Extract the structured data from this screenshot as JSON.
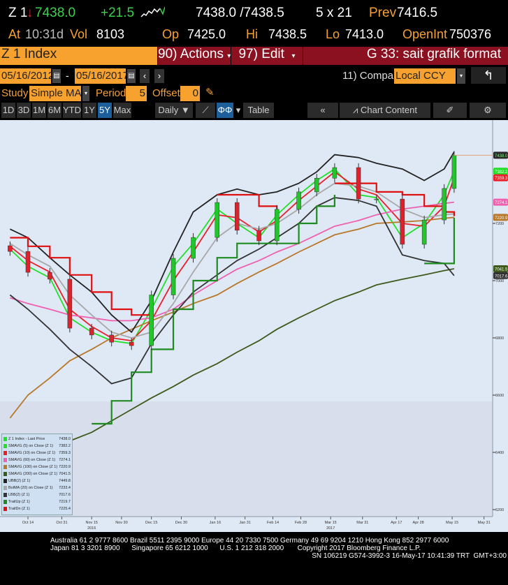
{
  "quote": {
    "ticker": "Z 1",
    "last": "7438.0",
    "change": "+21.5",
    "bid_ask": "7438.0 /7438.5",
    "size": "5 x 21",
    "prev_label": "Prev",
    "prev": "7416.5",
    "at_label": "At",
    "time": "10:31d",
    "vol_label": "Vol",
    "vol": "8103",
    "op_label": "Op",
    "op": "7425.0",
    "hi_label": "Hi",
    "hi": "7438.5",
    "lo_label": "Lo",
    "lo": "7413.0",
    "oi_label": "OpenInt",
    "oi": "750376"
  },
  "menu": {
    "security": "Z 1 Index",
    "actions": "90) Actions",
    "edit": "97) Edit",
    "title": "G 33: sait grafik format"
  },
  "range": {
    "start": "05/16/2012",
    "sep": "-",
    "end": "05/16/2017",
    "compare_label": "11) Compare",
    "compare": "Local CCY"
  },
  "study": {
    "label": "Study",
    "value": "Simple MA",
    "period_label": "Period",
    "period": "5",
    "offset_label": "Offset",
    "offset": "0"
  },
  "toolbar": {
    "periods": [
      "1D",
      "3D",
      "1M",
      "6M",
      "YTD",
      "1Y",
      "5Y",
      "Max"
    ],
    "selected": "5Y",
    "frequency": "Daily ▼",
    "table": "Table",
    "chart_content": "Chart Content"
  },
  "colors": {
    "accent": "#f7a12e",
    "menu_red": "#8b1020",
    "up": "#22c62a",
    "down": "#e0202a"
  },
  "chart_data": {
    "type": "candlestick-line",
    "yticks": [
      6200,
      6400,
      6600,
      6800,
      7000,
      7200
    ],
    "ylim": [
      6150,
      7500
    ],
    "xticks": [
      {
        "d": "2016-10-14",
        "l": "Oct 14"
      },
      {
        "d": "2016-10-31",
        "l": "Oct 31"
      },
      {
        "d": "2016-11-15",
        "l": "Nov 15"
      },
      {
        "d": "2016-11-30",
        "l": "Nov 30"
      },
      {
        "d": "2016-12-15",
        "l": "Dec 15"
      },
      {
        "d": "2016-12-30",
        "l": "Dec 30"
      },
      {
        "d": "2017-01-16",
        "l": "Jan 16"
      },
      {
        "d": "2017-01-31",
        "l": "Jan 31"
      },
      {
        "d": "2017-02-14",
        "l": "Feb 14"
      },
      {
        "d": "2017-02-28",
        "l": "Feb 28"
      },
      {
        "d": "2017-03-15",
        "l": "Mar 15"
      },
      {
        "d": "2017-03-31",
        "l": "Mar 31"
      },
      {
        "d": "2017-04-17",
        "l": "Apr 17"
      },
      {
        "d": "2017-04-28",
        "l": "Apr 28"
      },
      {
        "d": "2017-05-15",
        "l": "May 15"
      },
      {
        "d": "2017-05-31",
        "l": "May 31"
      }
    ],
    "years": [
      {
        "d": "2016-11-15",
        "l": "2016"
      },
      {
        "d": "2017-03-15",
        "l": "2017"
      }
    ],
    "dates": [
      "2016-10-05",
      "2016-10-14",
      "2016-10-25",
      "2016-11-04",
      "2016-11-15",
      "2016-11-25",
      "2016-12-05",
      "2016-12-15",
      "2016-12-26",
      "2017-01-05",
      "2017-01-17",
      "2017-01-27",
      "2017-02-07",
      "2017-02-16",
      "2017-02-27",
      "2017-03-08",
      "2017-03-17",
      "2017-03-29",
      "2017-04-07",
      "2017-04-20",
      "2017-05-01",
      "2017-05-11",
      "2017-05-16"
    ],
    "close": [
      7102,
      7029,
      7005,
      6834,
      6810,
      6785,
      6773,
      6950,
      7078,
      7151,
      7273,
      7176,
      7139,
      7249,
      7310,
      7358,
      7395,
      7285,
      7285,
      7127,
      7212,
      7322,
      7438
    ],
    "series": [
      {
        "name": "SMAVG (5) on Close (Z 1)",
        "last": "7382.2",
        "color": "#22e02a",
        "values": [
          7110,
          7050,
          7010,
          6870,
          6820,
          6790,
          6780,
          6900,
          7050,
          7130,
          7250,
          7200,
          7150,
          7230,
          7300,
          7350,
          7390,
          7300,
          7290,
          7150,
          7200,
          7300,
          7382.2
        ]
      },
      {
        "name": "SMAVG (10) on Close (Z 1)",
        "last": "7359.3",
        "color": "#e8202a",
        "values": [
          7120,
          7070,
          7030,
          6900,
          6840,
          6800,
          6790,
          6860,
          7000,
          7100,
          7230,
          7220,
          7170,
          7210,
          7280,
          7330,
          7380,
          7320,
          7300,
          7200,
          7190,
          7260,
          7359.3
        ]
      },
      {
        "name": "SMAVG (60) on Close (Z 1)",
        "last": "7274.1",
        "color": "#f060b0",
        "values": [
          6940,
          6920,
          6900,
          6880,
          6870,
          6860,
          6860,
          6870,
          6900,
          6950,
          7000,
          7040,
          7070,
          7100,
          7130,
          7160,
          7190,
          7210,
          7230,
          7250,
          7260,
          7270,
          7274.1
        ]
      },
      {
        "name": "SMAVG (100) on Close (Z 1)",
        "last": "7220.9",
        "color": "#b8782a",
        "values": [
          6520,
          6600,
          6660,
          6720,
          6760,
          6800,
          6830,
          6860,
          6890,
          6920,
          6950,
          6990,
          7030,
          7060,
          7100,
          7130,
          7160,
          7180,
          7200,
          7205,
          7210,
          7218,
          7220.9
        ]
      },
      {
        "name": "SMAVG (200) on Close (Z 1)",
        "last": "7041.5",
        "color": "#3d5a1a",
        "values": [
          6370,
          6390,
          6410,
          6440,
          6470,
          6510,
          6550,
          6590,
          6630,
          6670,
          6710,
          6750,
          6790,
          6830,
          6870,
          6900,
          6930,
          6960,
          6985,
          7005,
          7020,
          7035,
          7041.5
        ]
      },
      {
        "name": "UBB(2) (Z 1)",
        "last": "7449.8",
        "color": "#222222",
        "values": [
          7180,
          7150,
          7080,
          7020,
          6960,
          6880,
          6820,
          6930,
          7100,
          7240,
          7300,
          7320,
          7300,
          7310,
          7340,
          7380,
          7440,
          7430,
          7410,
          7390,
          7350,
          7390,
          7449.8
        ]
      },
      {
        "name": "BolMA (20) on Close (Z 1)",
        "last": "7233.4",
        "color": "#a8a8a8",
        "values": [
          7130,
          7090,
          7050,
          6950,
          6880,
          6820,
          6800,
          6820,
          6920,
          7030,
          7150,
          7200,
          7180,
          7200,
          7250,
          7300,
          7340,
          7330,
          7310,
          7250,
          7220,
          7230,
          7233.4
        ]
      },
      {
        "name": "LBB(2) (Z 1)",
        "last": "7017.6",
        "color": "#333333",
        "values": [
          6950,
          6900,
          6830,
          6760,
          6700,
          6640,
          6660,
          6780,
          6880,
          6960,
          7020,
          7070,
          7110,
          7150,
          7200,
          7260,
          7290,
          7280,
          7260,
          7090,
          7070,
          7060,
          7017.6
        ]
      },
      {
        "name": "TrailUp (Z 1)",
        "last": "7219.7",
        "color": "#1f8a20",
        "step": true,
        "values": [
          null,
          null,
          null,
          null,
          6500,
          6580,
          6680,
          6760,
          6900,
          7000,
          7080,
          7130,
          7130,
          7130,
          7200,
          7260,
          7300,
          null,
          null,
          null,
          7060,
          7060,
          7219.7
        ]
      },
      {
        "name": "TrailDn (Z 1)",
        "last": "7225.4",
        "color": "#e01010",
        "step": true,
        "values": [
          7150,
          7120,
          7080,
          7020,
          6960,
          6900,
          6880,
          6880,
          null,
          null,
          7300,
          7300,
          7260,
          7250,
          null,
          null,
          7340,
          7340,
          7310,
          7300,
          7260,
          7240,
          7225.4
        ]
      }
    ],
    "legend": {
      "placement": "bottom-left",
      "price_label": "Z 1 Index - Last Price",
      "price_last": "7438.0",
      "price_color": "#22e02a"
    }
  },
  "footer": {
    "line1": "Australia 61 2 9777 8600 Brazil 5511 2395 9000 Europe 44 20 7330 7500 Germany 49 69 9204 1210 Hong Kong 852 2977 6000",
    "line2": "Japan 81 3 3201 8900      Singapore 65 6212 1000      U.S. 1 212 318 2000       Copyright 2017 Bloomberg Finance L.P.",
    "line3": "SN 106219 G574-3992-3 16-May-17 10:41:39 TRT  GMT+3:00"
  }
}
